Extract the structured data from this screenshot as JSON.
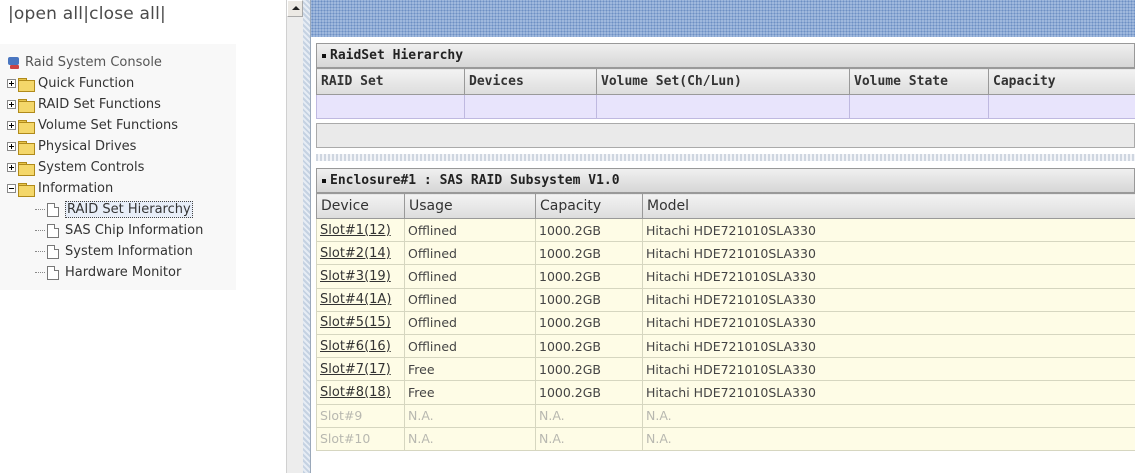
{
  "topbar": {
    "open_all": "|open all",
    "close_all": "|close all|"
  },
  "tree": {
    "root": "Raid System Console",
    "folders": [
      "Quick Function",
      "RAID Set Functions",
      "Volume Set Functions",
      "Physical Drives",
      "System Controls",
      "Information"
    ],
    "info_items": [
      "RAID Set Hierarchy",
      "SAS Chip Information",
      "System Information",
      "Hardware Monitor"
    ]
  },
  "raidset": {
    "title": "RaidSet Hierarchy",
    "headers": [
      "RAID Set",
      "Devices",
      "Volume Set(Ch/Lun)",
      "Volume State",
      "Capacity"
    ]
  },
  "enclosure": {
    "title": "Enclosure#1 : SAS RAID Subsystem V1.0",
    "headers": [
      "Device",
      "Usage",
      "Capacity",
      "Model"
    ],
    "rows": [
      [
        "Slot#1(12)",
        "Offlined",
        "1000.2GB",
        "Hitachi HDE721010SLA330"
      ],
      [
        "Slot#2(14)",
        "Offlined",
        "1000.2GB",
        "Hitachi HDE721010SLA330"
      ],
      [
        "Slot#3(19)",
        "Offlined",
        "1000.2GB",
        "Hitachi HDE721010SLA330"
      ],
      [
        "Slot#4(1A)",
        "Offlined",
        "1000.2GB",
        "Hitachi HDE721010SLA330"
      ],
      [
        "Slot#5(15)",
        "Offlined",
        "1000.2GB",
        "Hitachi HDE721010SLA330"
      ],
      [
        "Slot#6(16)",
        "Offlined",
        "1000.2GB",
        "Hitachi HDE721010SLA330"
      ],
      [
        "Slot#7(17)",
        "Free",
        "1000.2GB",
        "Hitachi HDE721010SLA330"
      ],
      [
        "Slot#8(18)",
        "Free",
        "1000.2GB",
        "Hitachi HDE721010SLA330"
      ],
      [
        "Slot#9",
        "N.A.",
        "N.A.",
        "N.A."
      ],
      [
        "Slot#10",
        "N.A.",
        "N.A.",
        "N.A."
      ]
    ]
  }
}
